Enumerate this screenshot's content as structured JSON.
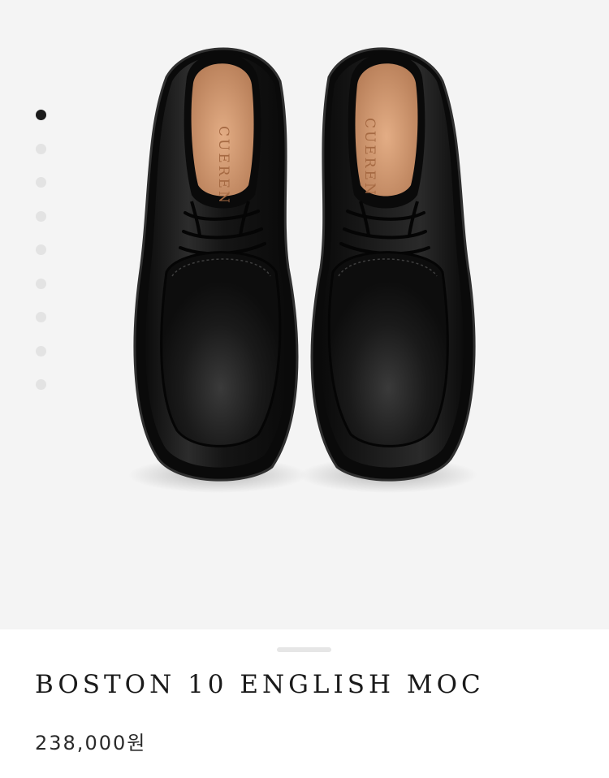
{
  "product": {
    "title": "BOSTON 10 ENGLISH MOC",
    "price": "238,000원",
    "insole_brand": "CUEREN"
  },
  "gallery": {
    "image_count": 9,
    "active_index": 0
  },
  "colors": {
    "gallery_background": "#f4f4f4",
    "active_dot": "#1b1b1b",
    "inactive_dot": "#e3e3e3",
    "leather": "#141414",
    "insole": "#d79f76"
  }
}
